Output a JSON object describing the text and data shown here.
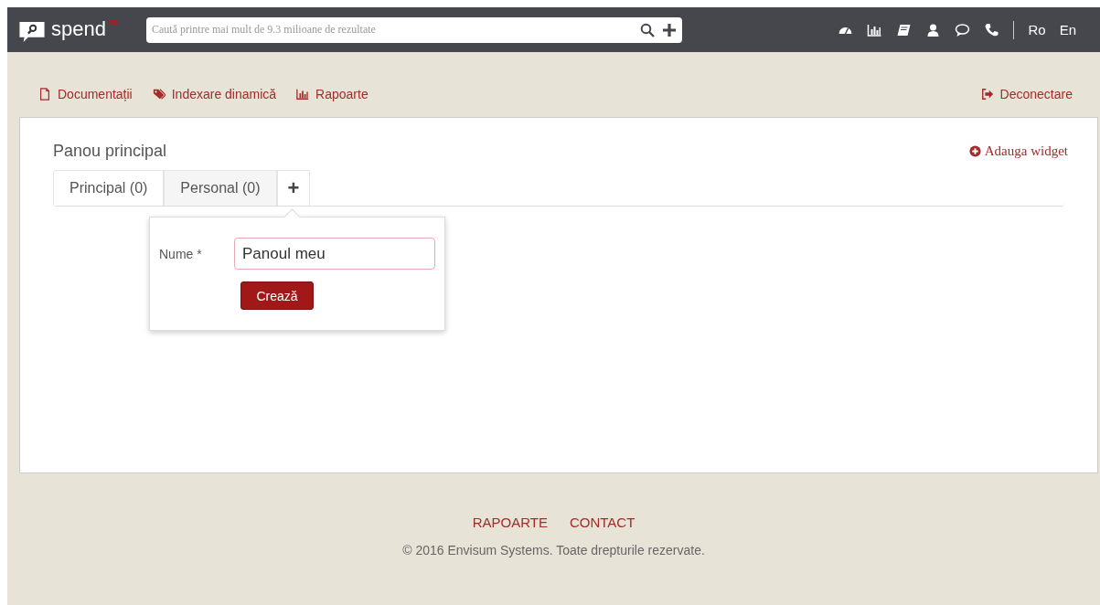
{
  "header": {
    "logo": "spend",
    "logo_suffix": "ro",
    "search": {
      "placeholder": "Caută printre mai mult de 9.3 milioane de rezultate"
    },
    "languages": [
      {
        "label": "Ro"
      },
      {
        "label": "En"
      }
    ]
  },
  "nav": {
    "links": [
      {
        "label": "Documentații"
      },
      {
        "label": "Indexare dinamică"
      },
      {
        "label": "Rapoarte"
      }
    ],
    "logout": "Deconectare"
  },
  "panel": {
    "title": "Panou principal",
    "add_widget": "Adauga widget",
    "tabs": [
      {
        "label": "Principal (0)",
        "selected": true
      },
      {
        "label": "Personal (0)",
        "selected": false
      }
    ],
    "add_tab": "+",
    "popover": {
      "label": "Nume *",
      "value": "Panoul meu",
      "button": "Crează"
    }
  },
  "footer": {
    "links": [
      "RAPOARTE",
      "CONTACT"
    ],
    "copyright": "© 2016 Envisum Systems. Toate drepturile rezervate."
  }
}
